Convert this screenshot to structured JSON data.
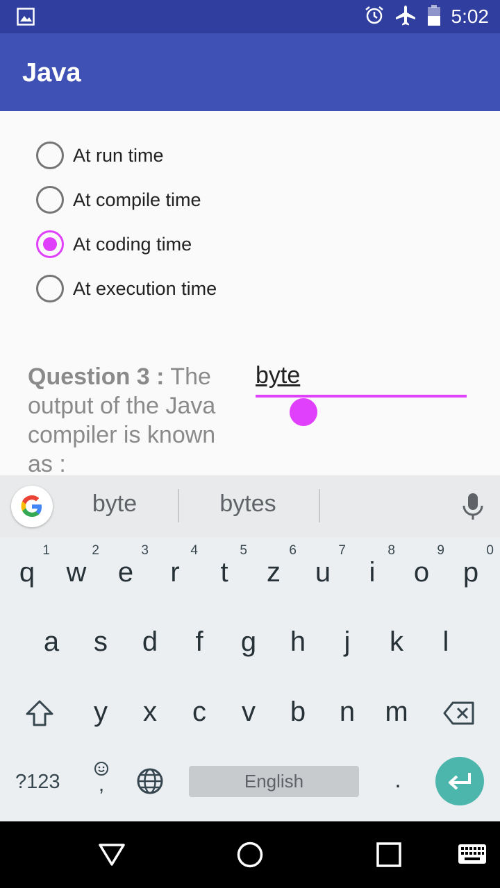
{
  "status_bar": {
    "time": "5:02",
    "icons": [
      "image-notification-icon",
      "alarm-icon",
      "airplane-mode-icon",
      "battery-icon"
    ]
  },
  "app_bar": {
    "title": "Java"
  },
  "options": [
    {
      "label": "At run time",
      "checked": false
    },
    {
      "label": "At compile time",
      "checked": false
    },
    {
      "label": "At coding time",
      "checked": true
    },
    {
      "label": "At execution time",
      "checked": false
    }
  ],
  "question": {
    "number": "Question 3 :",
    "text": " The output of the Java compiler is known as :",
    "answer": "byte"
  },
  "keyboard": {
    "suggestions": [
      "byte",
      "bytes"
    ],
    "row1": [
      {
        "key": "q",
        "hint": "1"
      },
      {
        "key": "w",
        "hint": "2"
      },
      {
        "key": "e",
        "hint": "3"
      },
      {
        "key": "r",
        "hint": "4"
      },
      {
        "key": "t",
        "hint": "5"
      },
      {
        "key": "z",
        "hint": "6"
      },
      {
        "key": "u",
        "hint": "7"
      },
      {
        "key": "i",
        "hint": "8"
      },
      {
        "key": "o",
        "hint": "9"
      },
      {
        "key": "p",
        "hint": "0"
      }
    ],
    "row2": [
      "a",
      "s",
      "d",
      "f",
      "g",
      "h",
      "j",
      "k",
      "l"
    ],
    "row3": [
      "y",
      "x",
      "c",
      "v",
      "b",
      "n",
      "m"
    ],
    "symbols_label": "?123",
    "comma": ",",
    "space_label": "English",
    "period": ".",
    "accent_color": "#e040fb",
    "enter_color": "#4db6ac"
  },
  "nav_bar": {
    "icons": [
      "back-icon",
      "home-icon",
      "recents-icon",
      "keyboard-switch-icon"
    ]
  }
}
